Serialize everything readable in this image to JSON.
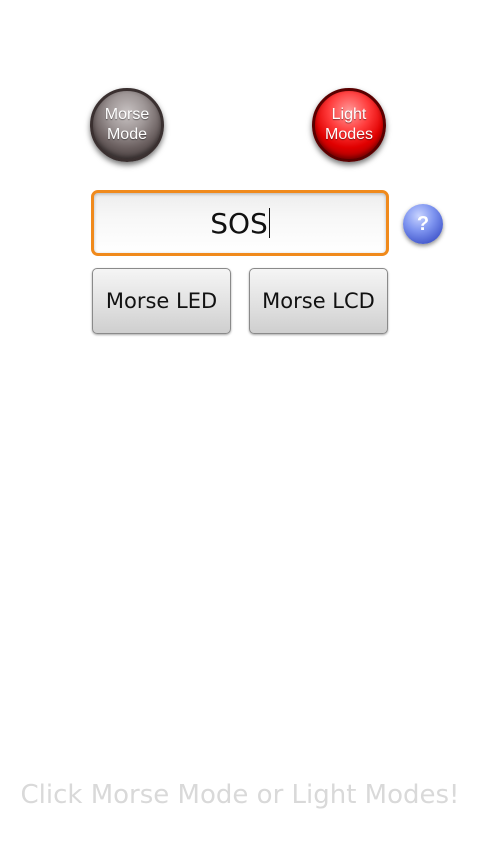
{
  "mode_buttons": {
    "morse_mode_label": "Morse\nMode",
    "light_modes_label": "Light\nModes"
  },
  "input": {
    "value": "SOS"
  },
  "help": {
    "symbol": "?"
  },
  "actions": {
    "morse_led_label": "Morse LED",
    "morse_lcd_label": "Morse LCD"
  },
  "hint_text": "Click Morse Mode or Light Modes!",
  "colors": {
    "input_focus_border": "#f08a1c",
    "light_modes_red": "#e00000",
    "help_blue": "#4a5fd0",
    "hint_gray": "#d9d9d9"
  }
}
